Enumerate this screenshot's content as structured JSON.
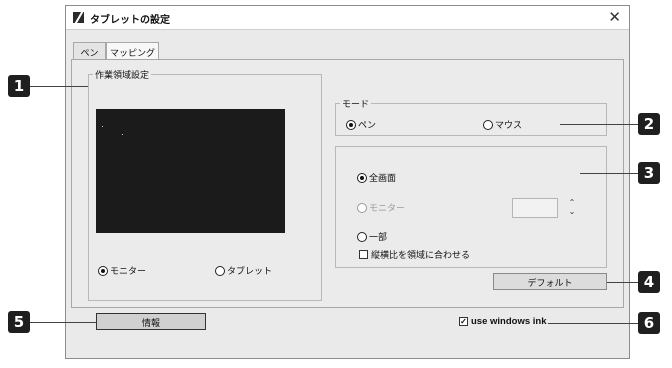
{
  "window": {
    "title": "タブレットの設定",
    "close_glyph": "✕"
  },
  "tabs": [
    {
      "label": "ペン",
      "selected": false
    },
    {
      "label": "マッピング",
      "selected": true
    }
  ],
  "work_area": {
    "group_label": "作業領域設定",
    "radios": [
      {
        "label": "モニター",
        "checked": true
      },
      {
        "label": "タブレット",
        "checked": false
      }
    ]
  },
  "mode": {
    "group_label": "モード",
    "radios": [
      {
        "label": "ペン",
        "checked": true
      },
      {
        "label": "マウス",
        "checked": false
      }
    ]
  },
  "area": {
    "radios": [
      {
        "label": "全画面",
        "checked": true,
        "enabled": true
      },
      {
        "label": "モニター",
        "checked": false,
        "enabled": false
      },
      {
        "label": "一部",
        "checked": false,
        "enabled": true
      }
    ],
    "keep_aspect_label": "縦横比を領域に合わせる",
    "keep_aspect_checked": false,
    "monitor_number": "",
    "spin_up": "⌃",
    "spin_down": "⌄"
  },
  "buttons": {
    "default_label": "デフォルト",
    "info_label": "情報"
  },
  "use_windows_ink": {
    "label": "use windows ink",
    "checked": true,
    "check_glyph": "✓"
  },
  "callouts": [
    "1",
    "2",
    "3",
    "4",
    "5",
    "6"
  ]
}
